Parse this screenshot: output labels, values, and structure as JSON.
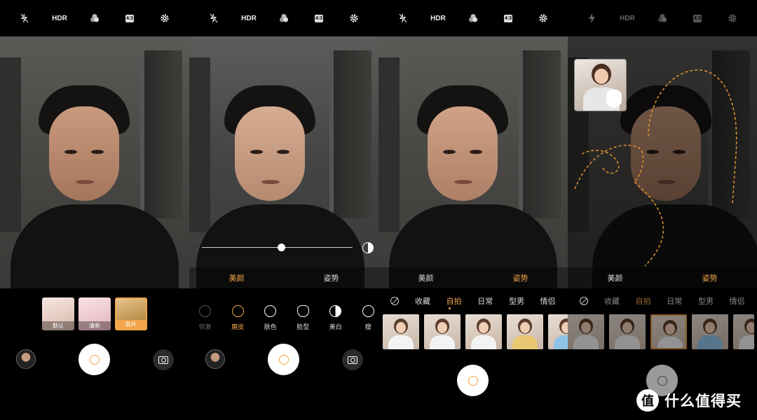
{
  "topbar": {
    "hdr": "HDR",
    "ratio": "4:3"
  },
  "panel1": {
    "filters": [
      {
        "label": "默认",
        "selected": false
      },
      {
        "label": "清新",
        "selected": false
      },
      {
        "label": "胶片",
        "selected": true
      }
    ]
  },
  "panel2": {
    "slider_value": 0.5,
    "modes": {
      "beauty": "美颜",
      "pose": "姿势"
    },
    "tools": [
      {
        "label": "恢复"
      },
      {
        "label": "磨皮"
      },
      {
        "label": "肤色"
      },
      {
        "label": "脸型"
      },
      {
        "label": "美白"
      },
      {
        "label": "瘦"
      }
    ]
  },
  "panel3": {
    "modes": {
      "beauty": "美颜",
      "pose": "姿势"
    },
    "categories": [
      "收藏",
      "自拍",
      "日常",
      "型男",
      "情侣"
    ]
  },
  "panel4": {
    "modes": {
      "beauty": "美颜",
      "pose": "姿势"
    },
    "categories": [
      "收藏",
      "自拍",
      "日常",
      "型男",
      "情侣"
    ]
  },
  "watermark": {
    "logo": "值",
    "text": "什么值得买"
  },
  "colors": {
    "accent": "#f2a54a",
    "background": "#000000"
  }
}
